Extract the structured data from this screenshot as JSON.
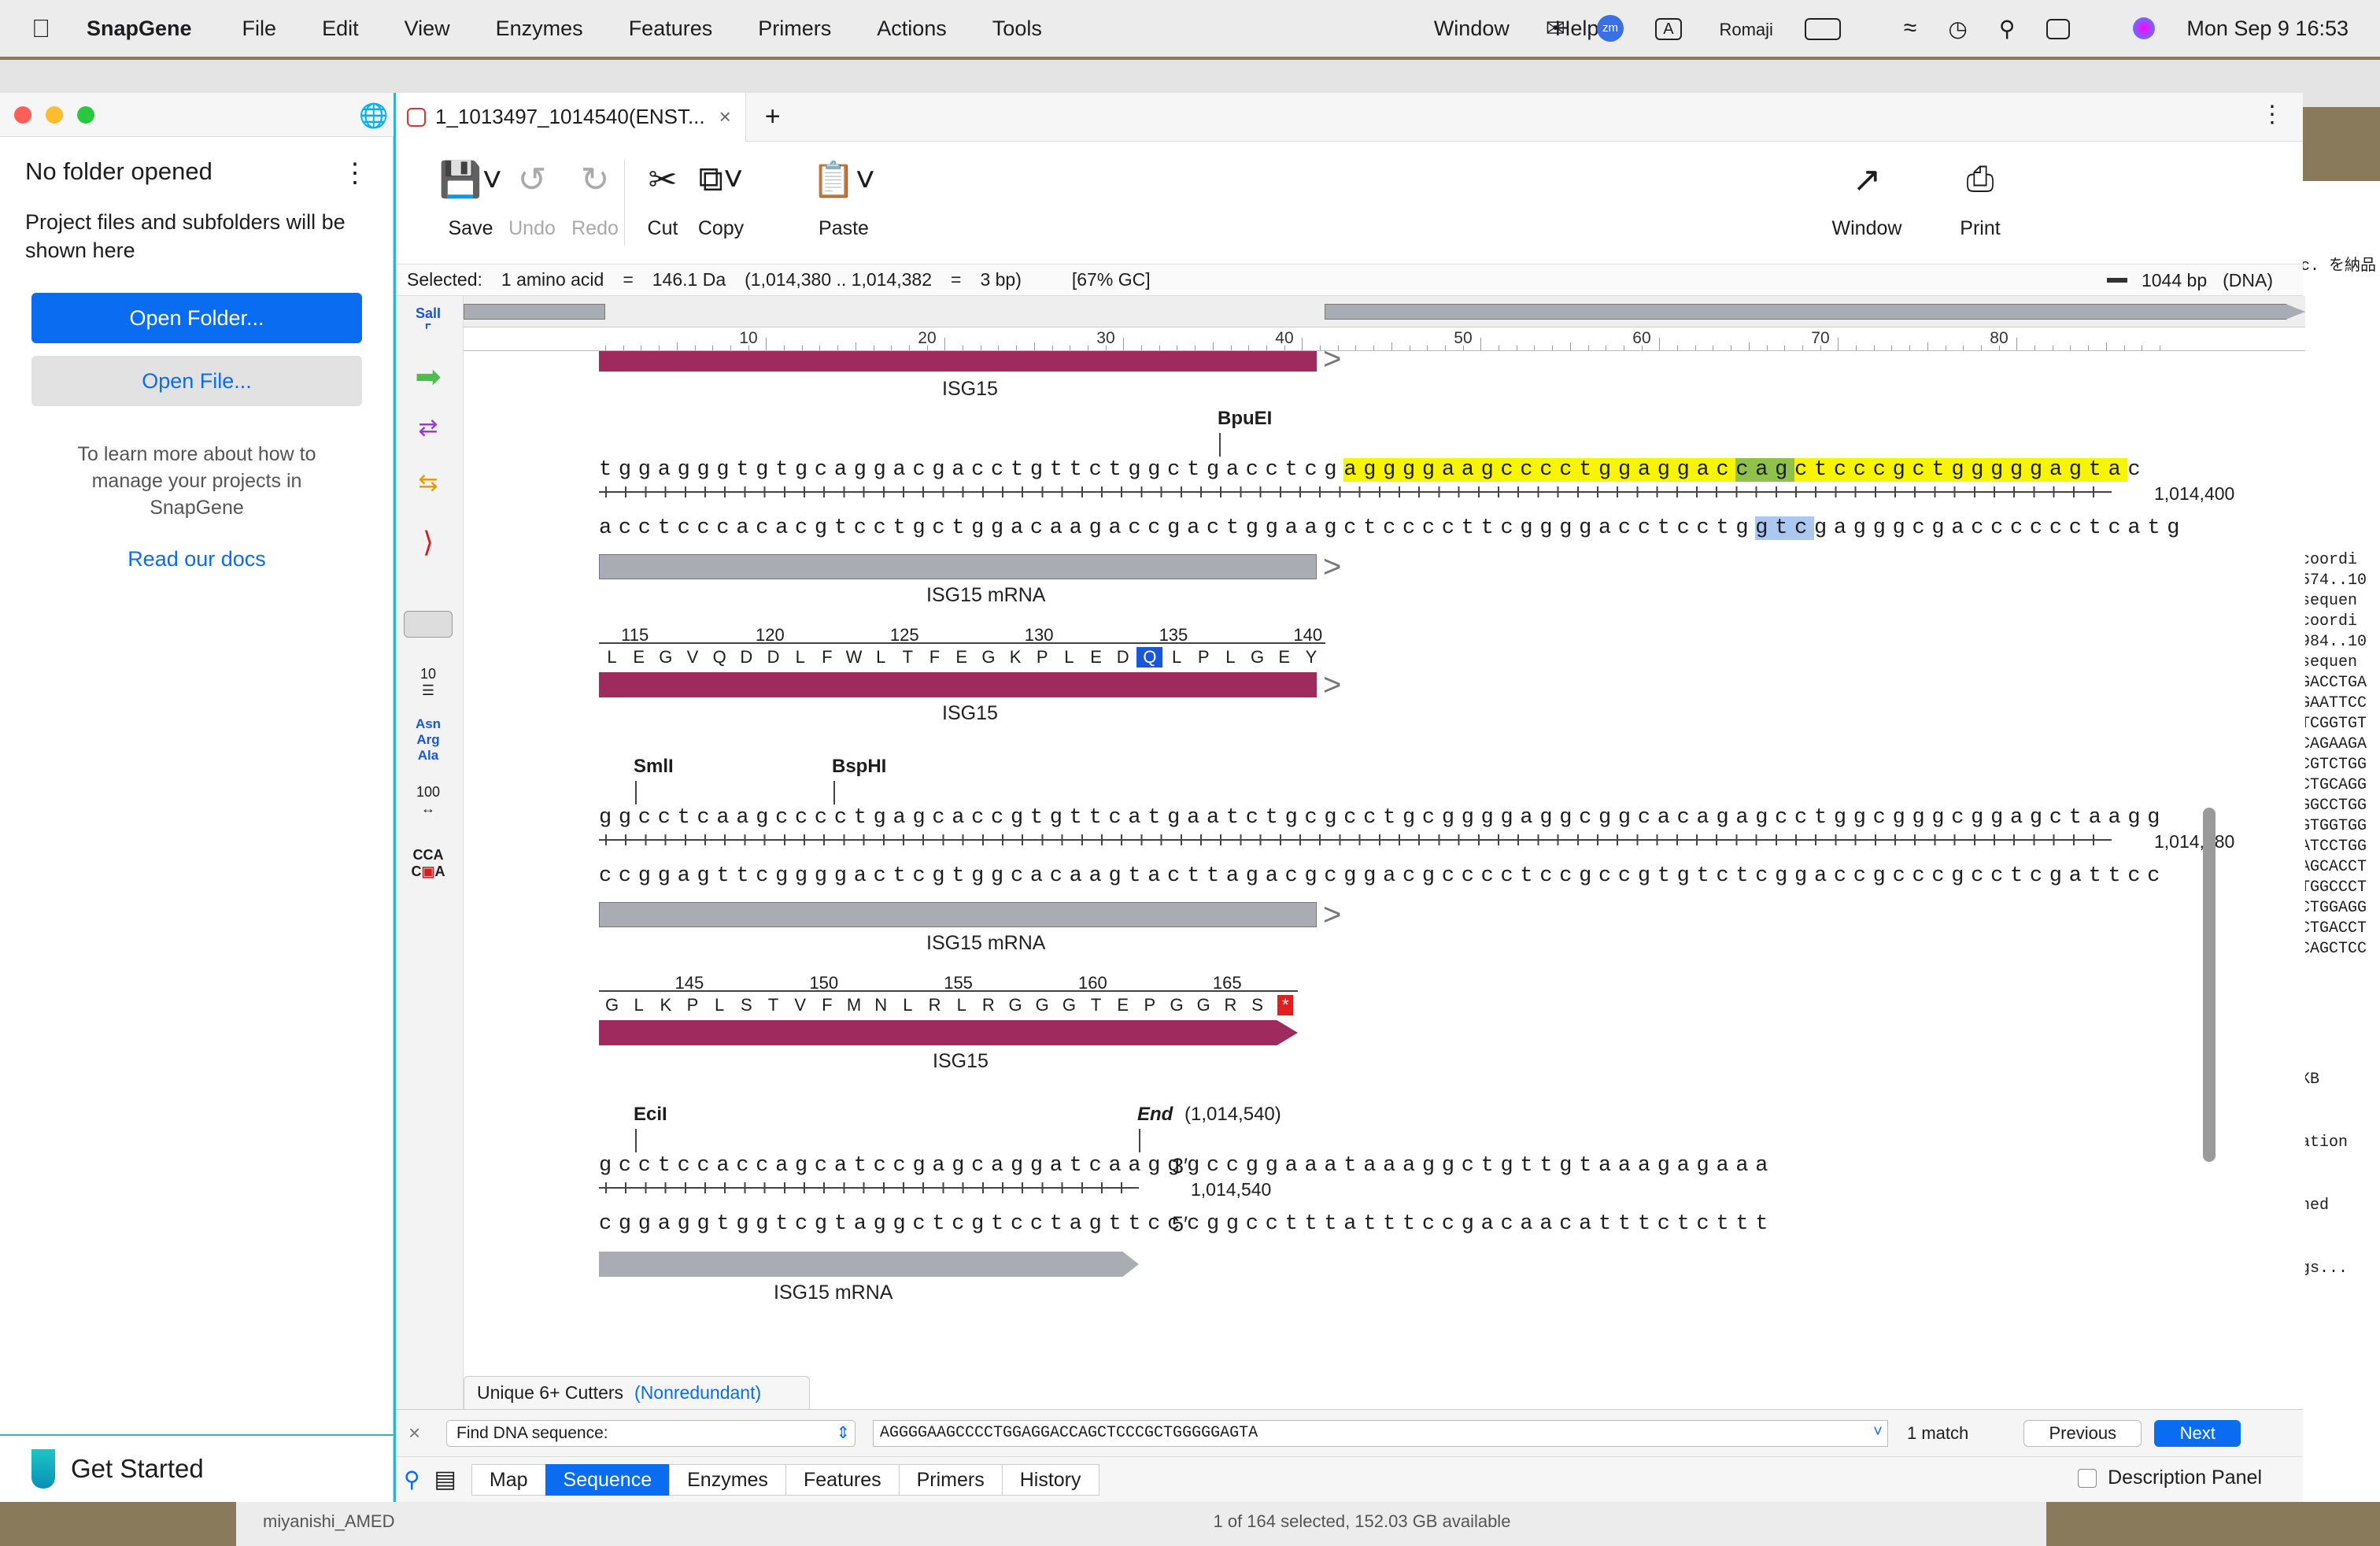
{
  "menubar": {
    "app_name": "SnapGene",
    "items": [
      "File",
      "Edit",
      "View",
      "Enzymes",
      "Features",
      "Primers",
      "Actions",
      "Tools",
      "Window",
      "Help"
    ],
    "input_mode": "Romaji",
    "datetime": "Mon Sep 9  16:53",
    "zoom_badge": "zm"
  },
  "left_panel": {
    "title": "No folder opened",
    "description": "Project files and subfolders will be shown here",
    "open_folder": "Open Folder...",
    "open_file": "Open File...",
    "learn_more": "To learn more about how to manage your projects in SnapGene",
    "docs_link": "Read our docs",
    "get_started": "Get Started"
  },
  "tab": {
    "title": "1_1013497_1014540(ENST...",
    "close": "×",
    "new": "+"
  },
  "toolbar": {
    "save": "Save",
    "undo": "Undo",
    "redo": "Redo",
    "cut": "Cut",
    "copy": "Copy",
    "paste": "Paste",
    "window": "Window",
    "print": "Print"
  },
  "selection": {
    "label": "Selected:",
    "amino": "1 amino acid",
    "eq1": "=",
    "mass": "146.1 Da",
    "range": "(1,014,380 .. 1,014,382",
    "eq2": "=",
    "bp": "3 bp)",
    "gc": "[67% GC]",
    "total": "1044 bp",
    "type": "(DNA)"
  },
  "ruler": [
    "10",
    "20",
    "30",
    "40",
    "50",
    "60",
    "70",
    "80"
  ],
  "sequence": {
    "block1": {
      "feature_top": "ISG15",
      "enzyme": "BpuEI",
      "top_pre": "tggagggtgtgcaggacgacctgttctggctgacctcg",
      "top_hl1": "aggggaagcccctggaggac",
      "top_sel": "cag",
      "top_hl2": "ctcccgctgggggagta",
      "top_post": "c",
      "bottom_pre": "acctcccacacgtcctgctggacaagaccgactggaagctccccttcggggacctcctg",
      "bottom_sel": "gtc",
      "bottom_post": "gagggcgacccccctcatg",
      "coord": "1,014,400",
      "feature_mrna": "ISG15 mRNA",
      "aa_nums": [
        "115",
        "120",
        "125",
        "130",
        "135",
        "140"
      ],
      "aa": [
        "L",
        "E",
        "G",
        "V",
        "Q",
        "D",
        "D",
        "L",
        "F",
        "W",
        "L",
        "T",
        "F",
        "E",
        "G",
        "K",
        "P",
        "L",
        "E",
        "D",
        "Q",
        "L",
        "P",
        "L",
        "G",
        "E",
        "Y"
      ],
      "aa_selected_index": 20,
      "feature_cds": "ISG15"
    },
    "block2": {
      "enzyme1": "SmlI",
      "enzyme2": "BspHI",
      "top": "ggcctcaagcccctgagcaccgtgttcatgaatctgcgcctgcggggaggcggcacagagcctggcgggcggagctaagg",
      "bottom": "ccggagttcggggactcgtggcacaagtacttagacgcggacgcccctccgccgtgtctcggaccgcccgcctcgattcc",
      "coord": "1,014,480",
      "feature_mrna": "ISG15 mRNA",
      "aa_nums": [
        "145",
        "150",
        "155",
        "160",
        "165"
      ],
      "aa": [
        "G",
        "L",
        "K",
        "P",
        "L",
        "S",
        "T",
        "V",
        "F",
        "M",
        "N",
        "L",
        "R",
        "L",
        "R",
        "G",
        "G",
        "G",
        "T",
        "E",
        "P",
        "G",
        "G",
        "R",
        "S"
      ],
      "stop": "*",
      "feature_cds": "ISG15"
    },
    "block3": {
      "enzyme": "EciI",
      "end_label": "End",
      "end_coord": "(1,014,540)",
      "top": "gcctccaccagcatccgagcaggatcaagggccggaaataaaggctgttgtaaagagaaa",
      "bottom": "cggaggtggtcgtaggctcgtcctagttcccggcctttatttccgacaacatttctcttt",
      "three_prime": "3′",
      "five_prime": "5′",
      "coord": "1,014,540",
      "feature_mrna": "ISG15 mRNA"
    }
  },
  "enzyme_tab": {
    "label": "Unique 6+ Cutters",
    "mode": "(Nonredundant)"
  },
  "findbar": {
    "close": "×",
    "mode": "Find DNA sequence:",
    "query": "AGGGGAAGCCCCTGGAGGACCAGCTCCCGCTGGGGGAGTA",
    "matches": "1 match",
    "previous": "Previous",
    "next": "Next"
  },
  "view_tabs": [
    "Map",
    "Sequence",
    "Enzymes",
    "Features",
    "Primers",
    "History"
  ],
  "view_tab_active": "Sequence",
  "description_panel": "Description Panel",
  "finder": {
    "folder": "miyanishi_AMED",
    "status": "1 of 164 selected, 152.03 GB available"
  },
  "right_window": {
    "text_lines": [
      "c. を納品",
      "coordi",
      "574..10",
      "sequen",
      "coordi",
      "984..10",
      "sequen",
      "GACCTGA",
      "GAATTCC",
      "TCGGTGT",
      "CAGAAGA",
      "CGTCTGG",
      "CTGCAGG",
      "GGCCTGG",
      "GTGGTGG",
      "ATCCTGG",
      "AGCACCT",
      "TGGCCCT",
      "CTGGAGG",
      "CTGACCT",
      "CAGCTCC",
      "KB",
      "ation",
      "ned",
      "gs..."
    ]
  },
  "colors": {
    "accent": "#0a6cf0",
    "cds_feature": "#9e2a5e",
    "mrna_feature": "#a9adb3",
    "highlight": "#f7f500",
    "selection": "#aac8f0",
    "overlap": "#8fc24a"
  }
}
